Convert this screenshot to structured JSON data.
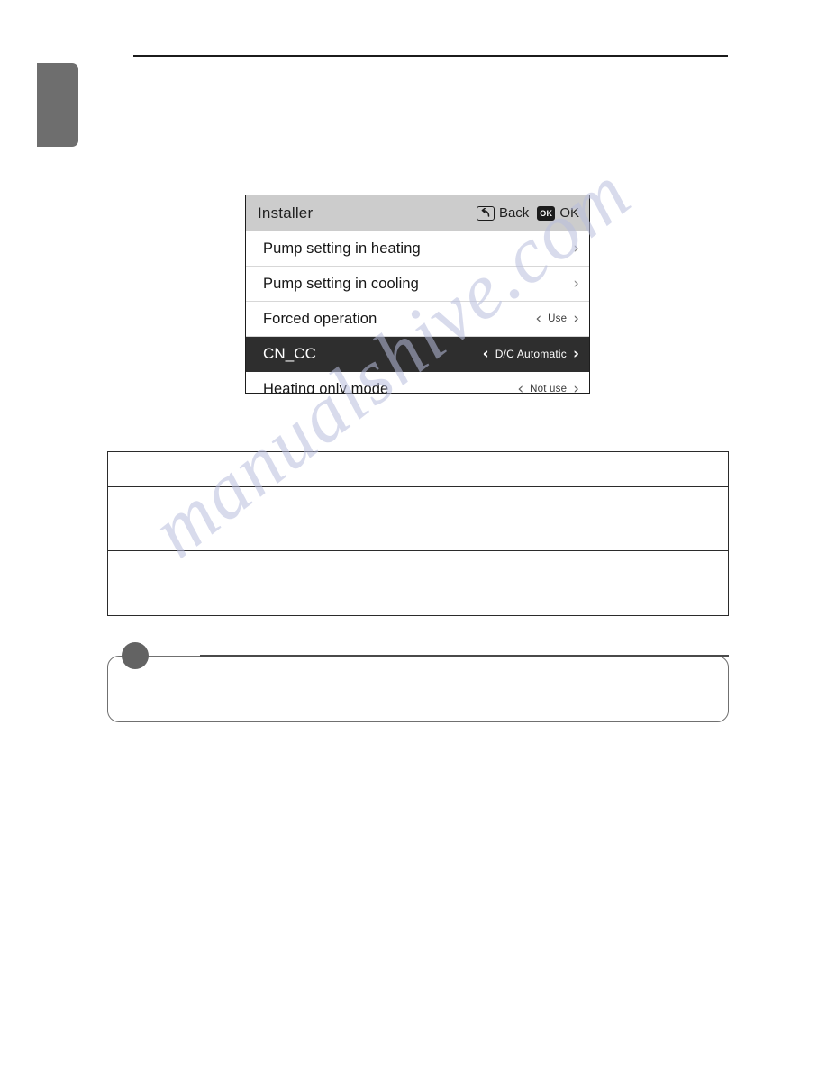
{
  "page": {
    "side_tab": "",
    "top_rule": ""
  },
  "device": {
    "header": {
      "title": "Installer",
      "actions": [
        {
          "icon": "back-arrow-icon",
          "label": "Back"
        },
        {
          "icon": "ok-key-icon",
          "label": "OK",
          "glyph": "OK"
        }
      ]
    },
    "rows": [
      {
        "label": "Pump setting in heating",
        "type": "submenu",
        "value": "",
        "left_chevron": "",
        "right_chevron": "›",
        "selected": false
      },
      {
        "label": "Pump setting in cooling",
        "type": "submenu",
        "value": "",
        "left_chevron": "",
        "right_chevron": "›",
        "selected": false
      },
      {
        "label": "Forced operation",
        "type": "stepper",
        "value": "Use",
        "left_chevron": "‹",
        "right_chevron": "›",
        "selected": false
      },
      {
        "label": "CN_CC",
        "type": "stepper",
        "value": "D/C Automatic",
        "left_chevron": "‹",
        "right_chevron": "›",
        "selected": true
      },
      {
        "label": "Heating only mode",
        "type": "stepper",
        "value": "Not use",
        "left_chevron": "‹",
        "right_chevron": "›",
        "selected": false
      }
    ]
  },
  "spec_table": {
    "rows": [
      {
        "label": "",
        "value": ""
      },
      {
        "label": "",
        "value": ""
      },
      {
        "label": "",
        "value": ""
      },
      {
        "label": "",
        "value": ""
      }
    ]
  },
  "note": {
    "bullet": "note-bullet-icon",
    "title": "",
    "body": ""
  },
  "watermark": {
    "text": "manualshive.com"
  },
  "colors": {
    "selected_row_bg": "#2e2e2e",
    "header_bg": "#cccccc",
    "side_tab": "#6e6e6e",
    "note_bullet": "#636363",
    "watermark": "#b9bede"
  }
}
